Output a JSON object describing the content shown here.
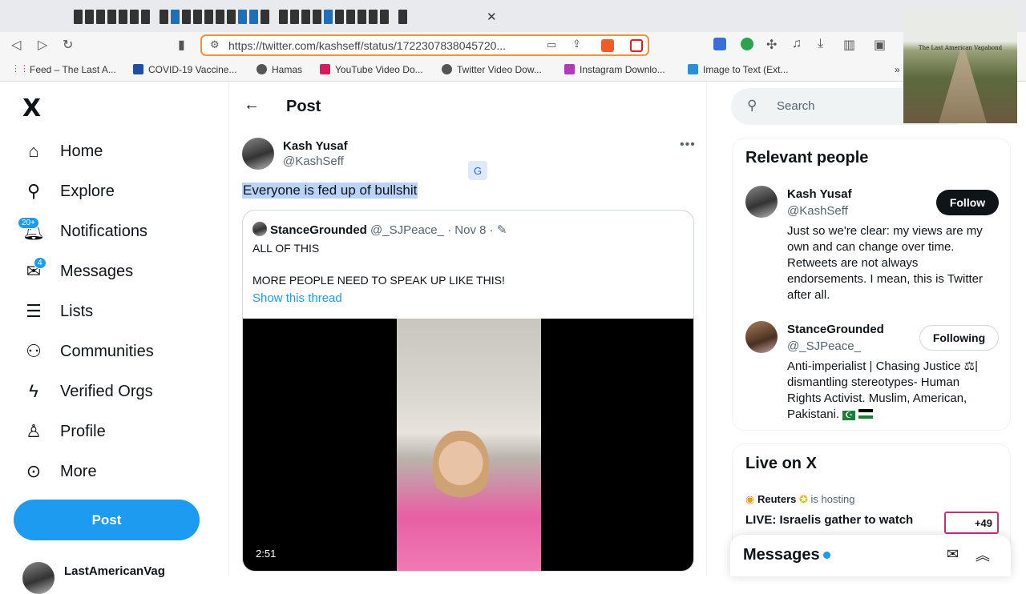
{
  "browser": {
    "url": "https://twitter.com/kashseff/status/1722307838045720...",
    "bookmarks": [
      {
        "label": "Feed – The Last A...",
        "color": "#f39c12"
      },
      {
        "label": "COVID-19 Vaccine...",
        "color": "#1f4fa0"
      },
      {
        "label": "Hamas",
        "color": "#555555"
      },
      {
        "label": "YouTube Video Do...",
        "color": "#d81b60"
      },
      {
        "label": "Twitter Video Dow...",
        "color": "#555555"
      },
      {
        "label": "Instagram Downlo...",
        "color": "#b03ab8"
      },
      {
        "label": "Image to Text (Ext...",
        "color": "#2a8fd8"
      }
    ]
  },
  "sidebar": {
    "logo": "X",
    "items": [
      {
        "label": "Home",
        "icon": "home-icon"
      },
      {
        "label": "Explore",
        "icon": "search-icon"
      },
      {
        "label": "Notifications",
        "icon": "bell-icon",
        "badge": "20+"
      },
      {
        "label": "Messages",
        "icon": "mail-icon",
        "badge": "4"
      },
      {
        "label": "Lists",
        "icon": "list-icon"
      },
      {
        "label": "Communities",
        "icon": "people-icon"
      },
      {
        "label": "Verified Orgs",
        "icon": "lightning-icon"
      },
      {
        "label": "Profile",
        "icon": "person-icon"
      },
      {
        "label": "More",
        "icon": "more-circle-icon"
      }
    ],
    "post_button": "Post",
    "account": "LastAmericanVag"
  },
  "main": {
    "header_title": "Post",
    "tweet": {
      "author": "Kash Yusaf",
      "handle": "@KashSeff",
      "text": "Everyone is fed up of bullshit"
    },
    "quote": {
      "author": "StanceGrounded",
      "meta": "@_SJPeace_ · Nov 8 ·",
      "line1": "ALL OF THIS",
      "line2": "MORE PEOPLE NEED TO SPEAK UP LIKE THIS!",
      "link": "Show this thread",
      "video_duration": "2:51"
    }
  },
  "right": {
    "search_placeholder": "Search",
    "relevant_title": "Relevant people",
    "people": [
      {
        "name": "Kash Yusaf",
        "handle": "@KashSeff",
        "button": "Follow",
        "bio": [
          "Just so we're clear: my views are my",
          "own and can change over time.",
          "Retweets are not always",
          "endorsements. I mean, this is Twitter",
          "after all."
        ]
      },
      {
        "name": "StanceGrounded",
        "handle": "@_SJPeace_",
        "button": "Following",
        "bio": [
          "Anti-imperialist | Chasing Justice ⚖|",
          "dismantling stereotypes- Human",
          "Rights Activist. Muslim, American,",
          "Pakistani."
        ]
      }
    ],
    "live_title": "Live on X",
    "live_host": "Reuters",
    "live_host_suffix": "is hosting",
    "live_event": "LIVE: Israelis gather to watch",
    "live_count": "+49",
    "messages_title": "Messages"
  },
  "overlay_caption": "The Last American Vagabond"
}
